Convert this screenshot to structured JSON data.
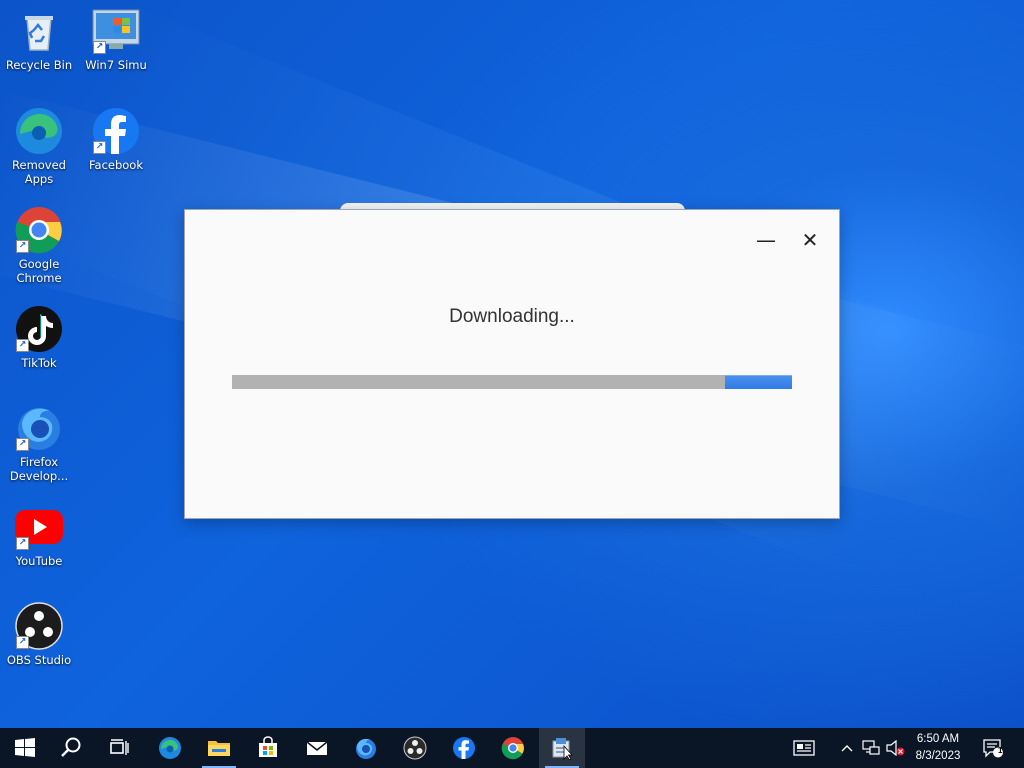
{
  "desktop": {
    "icons": [
      {
        "label": "Recycle Bin"
      },
      {
        "label": "Win7 Simu"
      },
      {
        "label": "Removed Apps"
      },
      {
        "label": "Facebook"
      },
      {
        "label": "Google Chrome"
      },
      {
        "label": "TikTok"
      },
      {
        "label": "Firefox Develop..."
      },
      {
        "label": "YouTube"
      },
      {
        "label": "OBS Studio"
      }
    ]
  },
  "dialog": {
    "minimize_glyph": "—",
    "close_glyph": "✕",
    "status_text": "Downloading...",
    "progress": {
      "fill_start": 0.88,
      "fill_end": 1.0,
      "fill_color": "#2f7be6",
      "track_color": "#b2b2b2"
    }
  },
  "taskbar": {
    "items": [
      {
        "icon": "windows-start-icon"
      },
      {
        "icon": "search-icon"
      },
      {
        "icon": "task-view-icon"
      },
      {
        "icon": "edge-icon"
      },
      {
        "icon": "file-explorer-icon"
      },
      {
        "icon": "microsoft-store-icon"
      },
      {
        "icon": "mail-icon"
      },
      {
        "icon": "firefox-developer-icon"
      },
      {
        "icon": "obs-studio-icon"
      },
      {
        "icon": "facebook-icon"
      },
      {
        "icon": "chrome-icon"
      },
      {
        "icon": "installer-icon"
      }
    ],
    "clock": {
      "time": "6:50 AM",
      "date": "8/3/2023"
    },
    "notification_count": "1"
  }
}
